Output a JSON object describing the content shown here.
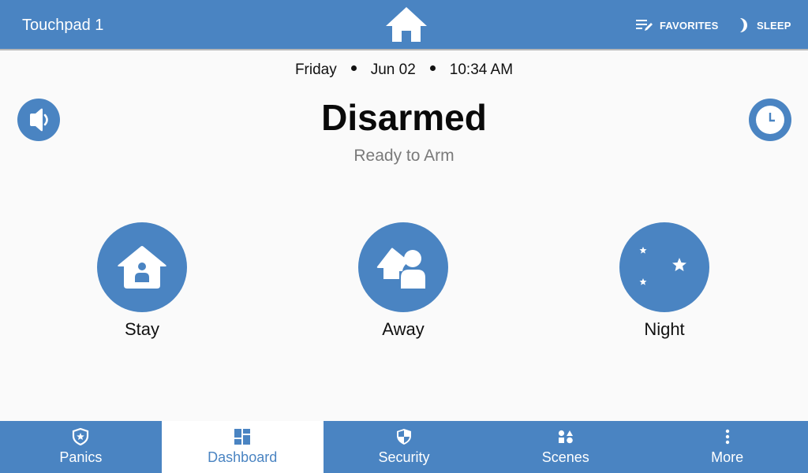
{
  "header": {
    "title": "Touchpad 1",
    "home_icon": "home-icon",
    "actions": [
      {
        "label": "FAVORITES",
        "icon": "favorites-list-edit-icon"
      },
      {
        "label": "SLEEP",
        "icon": "moon-icon"
      }
    ]
  },
  "datetime": {
    "day": "Friday",
    "date": "Jun 02",
    "time": "10:34 AM"
  },
  "status": {
    "title": "Disarmed",
    "subtitle": "Ready to Arm"
  },
  "side_buttons": {
    "left": {
      "icon": "volume-icon"
    },
    "right": {
      "icon": "clock-icon"
    }
  },
  "arm_modes": [
    {
      "label": "Stay",
      "icon": "home-person-icon"
    },
    {
      "label": "Away",
      "icon": "person-leaving-home-icon"
    },
    {
      "label": "Night",
      "icon": "moon-stars-icon"
    }
  ],
  "nav": {
    "active": "Dashboard",
    "items": [
      {
        "label": "Panics",
        "icon": "shield-star-icon"
      },
      {
        "label": "Dashboard",
        "icon": "dashboard-icon"
      },
      {
        "label": "Security",
        "icon": "security-shield-icon"
      },
      {
        "label": "Scenes",
        "icon": "scenes-shapes-icon"
      },
      {
        "label": "More",
        "icon": "more-vertical-icon"
      }
    ]
  },
  "colors": {
    "primary": "#4a84c2",
    "background": "#fafafa",
    "subtitle": "#7a7a7a"
  }
}
